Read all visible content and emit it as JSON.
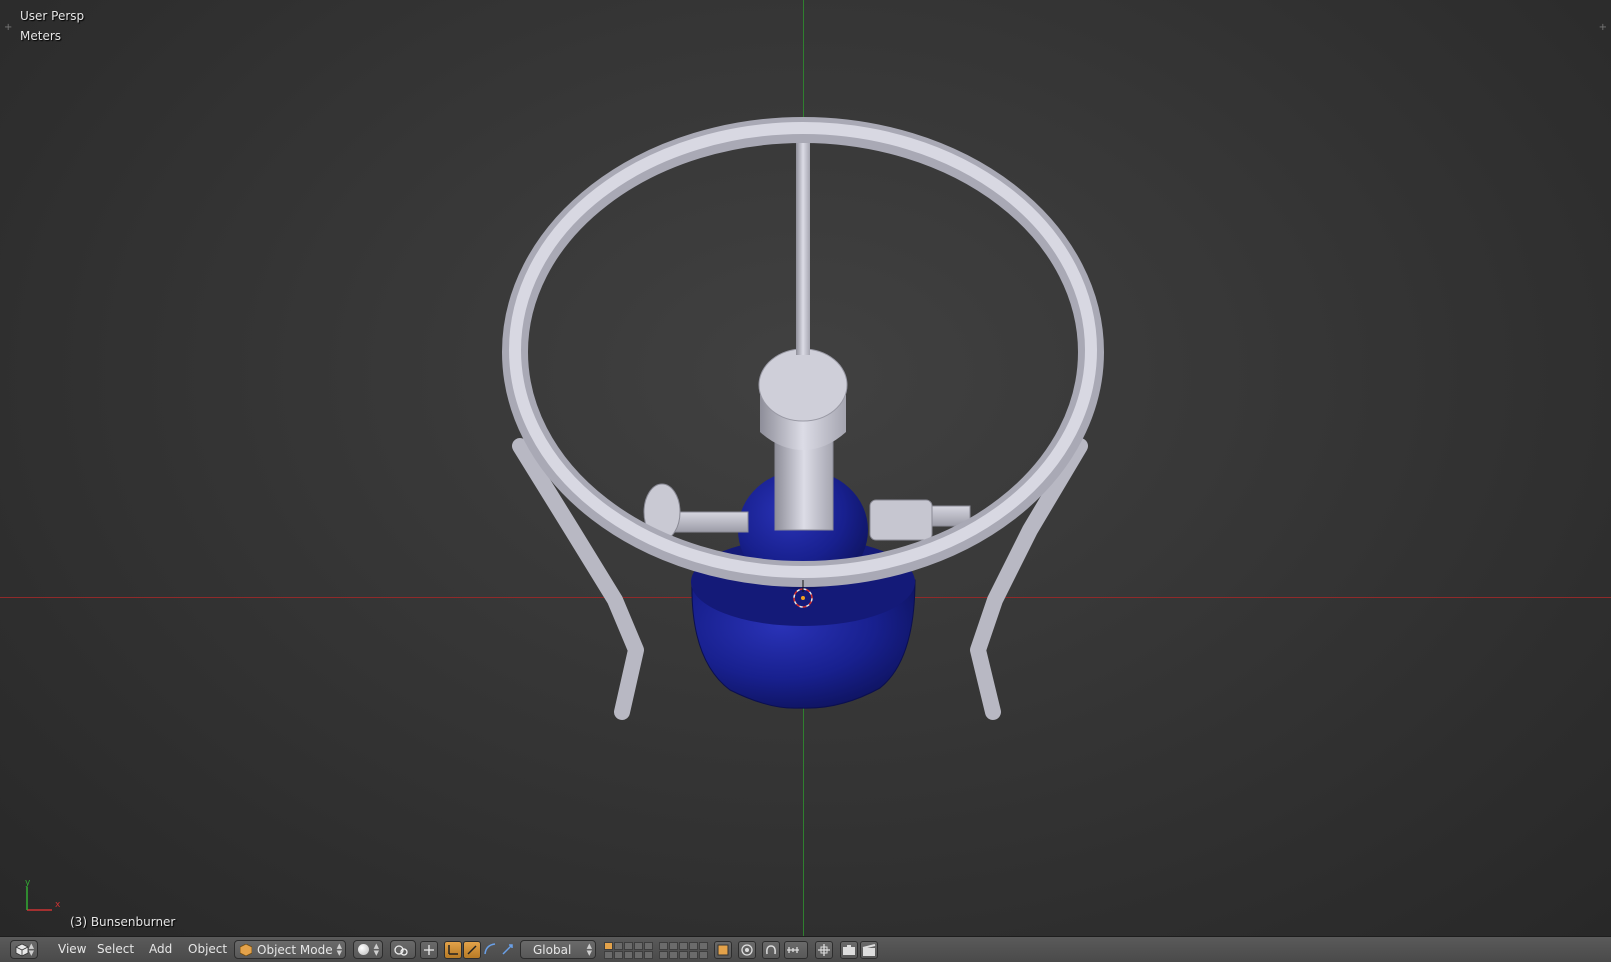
{
  "viewport": {
    "view_name": "User Persp",
    "units": "Meters",
    "active_object": "(3) Bunsenburner",
    "axis_gizmo": {
      "x_label": "x",
      "y_label": "y"
    }
  },
  "header": {
    "editor_type_icon": "3d-view-cube-icon",
    "menus": [
      "View",
      "Select",
      "Add",
      "Object"
    ],
    "mode": "Object Mode",
    "shading_icon": "solid-sphere-icon",
    "pivot_icon": "pivot-point-icon",
    "transform_orientation": "Global",
    "manipulator_icons": [
      "translate-icon",
      "rotate-icon",
      "scale-icon"
    ]
  },
  "colors": {
    "background": "#393939",
    "x_axis": "#8f2a2a",
    "y_axis": "#2f7f2f",
    "burner_blue": "#1a1f8a",
    "metal_grey": "#c8c8d2",
    "accent_orange": "#e2a249"
  }
}
